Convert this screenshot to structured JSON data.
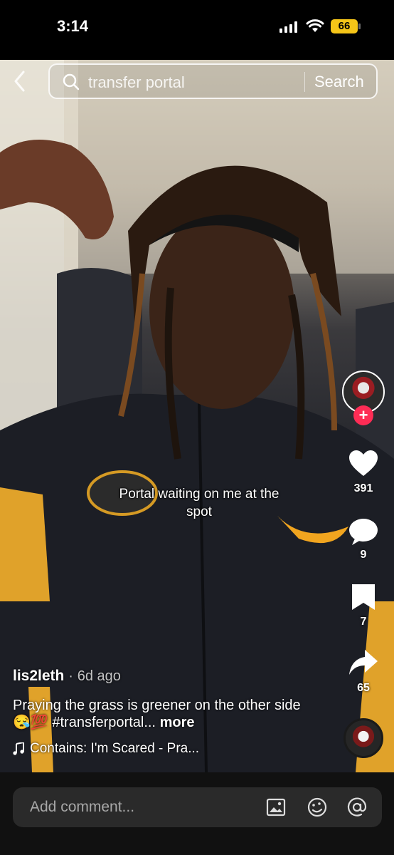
{
  "status_bar": {
    "time": "3:14",
    "battery": "66",
    "battery_color": "#f5c518"
  },
  "search": {
    "query": "transfer portal",
    "button_label": "Search",
    "icon": "search-icon",
    "back_icon": "chevron-left-icon"
  },
  "video": {
    "caption_line1": "Portal waiting on me at the",
    "caption_line2": "spot"
  },
  "actions": {
    "like_count": "391",
    "comment_count": "9",
    "bookmark_count": "7",
    "share_count": "65",
    "follow_icon": "plus-icon",
    "accent": "#fe2c55"
  },
  "post": {
    "author": "lis2leth",
    "separator": "·",
    "age": "6d ago",
    "description": "Praying the grass is greener on the other side😪💯 #transferportal...",
    "more_label": "more",
    "music": "Contains: I'm Scared - Pra..."
  },
  "comment_bar": {
    "placeholder": "Add comment...",
    "icons": [
      "image-icon",
      "emoji-icon",
      "mention-icon"
    ]
  }
}
